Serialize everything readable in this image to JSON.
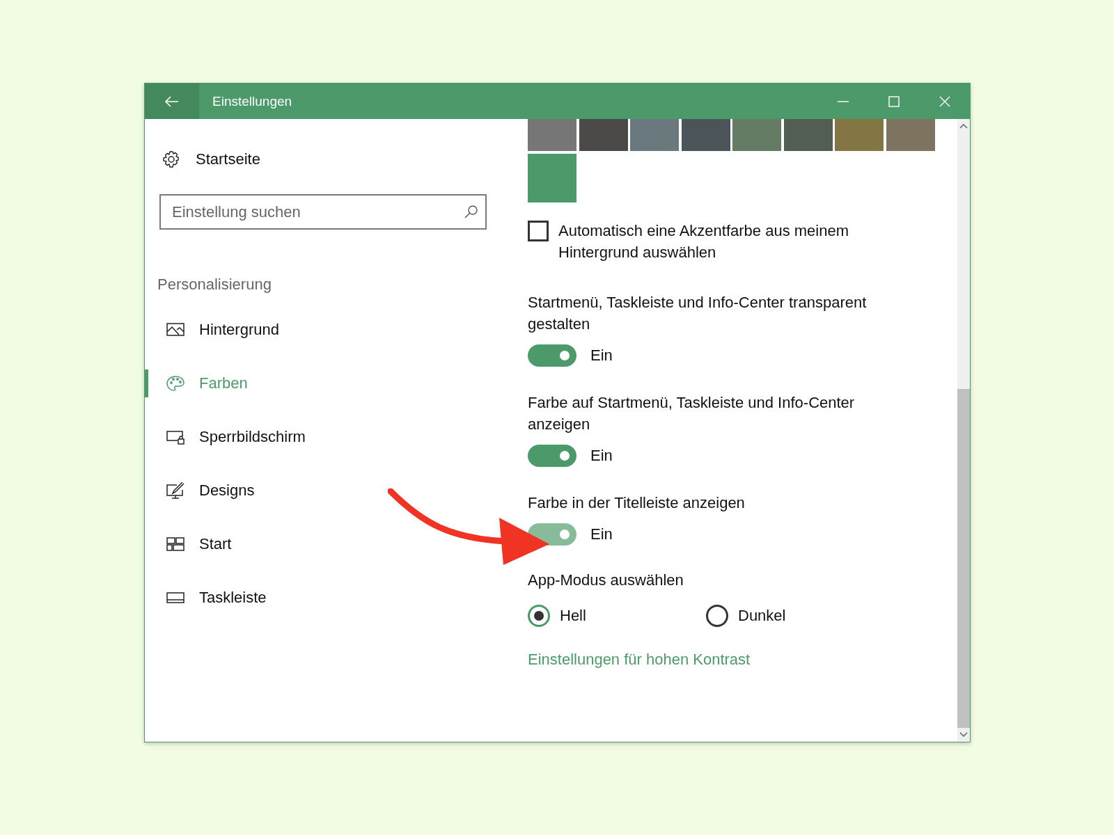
{
  "window": {
    "title": "Einstellungen"
  },
  "sidebar": {
    "home": "Startseite",
    "search": {
      "placeholder": "Einstellung suchen"
    },
    "section": "Personalisierung",
    "items": [
      {
        "label": "Hintergrund",
        "kind": "image",
        "selected": false
      },
      {
        "label": "Farben",
        "kind": "palette",
        "selected": true
      },
      {
        "label": "Sperrbildschirm",
        "kind": "lock",
        "selected": false
      },
      {
        "label": "Designs",
        "kind": "brush",
        "selected": false
      },
      {
        "label": "Start",
        "kind": "tiles",
        "selected": false
      },
      {
        "label": "Taskleiste",
        "kind": "taskbar",
        "selected": false
      }
    ]
  },
  "content": {
    "swatches": [
      {
        "color": "#767676"
      },
      {
        "color": "#4c4a48"
      },
      {
        "color": "#69797e"
      },
      {
        "color": "#4a5459"
      },
      {
        "color": "#647c64"
      },
      {
        "color": "#525e54"
      },
      {
        "color": "#847545"
      },
      {
        "color": "#7e735f"
      },
      {
        "color": "#4c9a69"
      }
    ],
    "auto_accent": {
      "label": "Automatisch eine Akzentfarbe aus meinem Hintergrund auswählen",
      "checked": false
    },
    "toggles": [
      {
        "label": "Startmenü, Taskleiste und Info-Center transparent gestalten",
        "on": true,
        "pressed": false,
        "state_text": "Ein"
      },
      {
        "label": "Farbe auf Startmenü, Taskleiste und Info-Center anzeigen",
        "on": true,
        "pressed": false,
        "state_text": "Ein"
      },
      {
        "label": "Farbe in der Titelleiste anzeigen",
        "on": true,
        "pressed": true,
        "state_text": "Ein"
      }
    ],
    "app_mode": {
      "label": "App-Modus auswählen",
      "options": [
        {
          "label": "Hell",
          "selected": true
        },
        {
          "label": "Dunkel",
          "selected": false
        }
      ]
    },
    "link": "Einstellungen für hohen Kontrast"
  }
}
